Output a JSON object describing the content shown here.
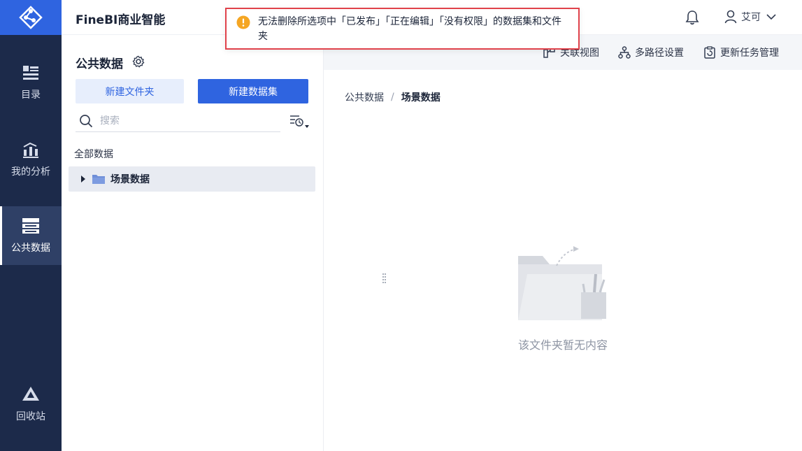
{
  "header": {
    "app_title": "FineBI商业智能",
    "user_name": "艾可"
  },
  "rail": {
    "items": [
      {
        "label": "目录",
        "icon": "catalog-icon"
      },
      {
        "label": "我的分析",
        "icon": "analysis-icon"
      },
      {
        "label": "公共数据",
        "icon": "public-data-icon",
        "active": true
      },
      {
        "label": "回收站",
        "icon": "recycle-bin-icon"
      }
    ]
  },
  "panel": {
    "title": "公共数据",
    "new_folder_label": "新建文件夹",
    "new_dataset_label": "新建数据集",
    "search_placeholder": "搜索",
    "all_data_label": "全部数据",
    "tree": [
      {
        "label": "场景数据",
        "icon": "folder-icon",
        "expanded": false
      }
    ]
  },
  "toolbar": {
    "items": [
      {
        "label": "关联视图",
        "icon": "relation-view-icon"
      },
      {
        "label": "多路径设置",
        "icon": "multi-path-icon"
      },
      {
        "label": "更新任务管理",
        "icon": "update-task-icon"
      }
    ]
  },
  "breadcrumb": {
    "root": "公共数据",
    "separator": "/",
    "current": "场景数据"
  },
  "empty_state": {
    "text": "该文件夹暂无内容"
  },
  "toast": {
    "type": "warning",
    "message": "无法删除所选项中「已发布」「正在编辑」「没有权限」的数据集和文件夹"
  },
  "colors": {
    "rail_bg": "#1c2a4a",
    "brand_blue": "#2f64e0",
    "warning_orange": "#f5a623",
    "toast_border": "#e0424b"
  }
}
